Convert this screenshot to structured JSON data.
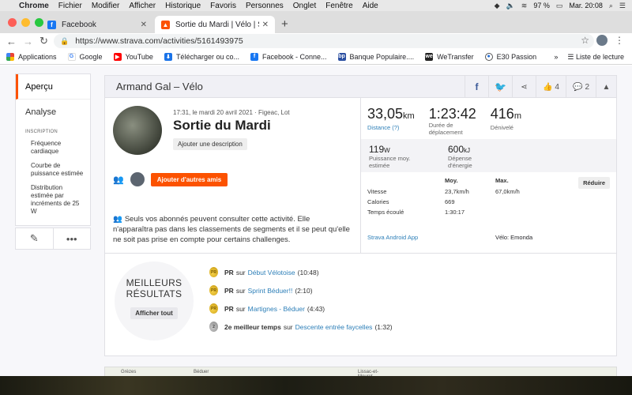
{
  "menubar": {
    "app": "Chrome",
    "items": [
      "Fichier",
      "Modifier",
      "Afficher",
      "Historique",
      "Favoris",
      "Personnes",
      "Onglet",
      "Fenêtre",
      "Aide"
    ],
    "battery": "97 %",
    "clock": "Mar. 20:08"
  },
  "tabs": [
    {
      "title": "Facebook",
      "icon": "facebook-icon",
      "color": "#1877f2"
    },
    {
      "title": "Sortie du Mardi | Vélo | Strava",
      "icon": "strava-icon",
      "color": "#fc5200"
    }
  ],
  "toolbar": {
    "url": "https://www.strava.com/activities/5161493975"
  },
  "bookmarks": {
    "items": [
      "Applications",
      "Google",
      "YouTube",
      "Télécharger ou co...",
      "Facebook - Conne...",
      "Banque Populaire....",
      "WeTransfer",
      "E30 Passion"
    ],
    "more": "»",
    "reading_list": "Liste de lecture"
  },
  "sidenav": {
    "overview": "Aperçu",
    "analysis": "Analyse",
    "caption": "INSCRIPTION",
    "subitems": [
      "Fréquence cardiaque",
      "Courbe de puissance estimée",
      "Distribution estimée par incréments de 25 W"
    ]
  },
  "activity": {
    "header": "Armand Gal – Vélo",
    "kudos": "4",
    "comments": "2",
    "meta": "17:31, le mardi 20 avril 2021 · Figeac, Lot",
    "title": "Sortie du Mardi",
    "add_description": "Ajouter une description",
    "add_friends": "Ajouter d'autres amis",
    "privacy": "Seuls vos abonnés peuvent consulter cette activité. Elle n'apparaîtra pas dans les classements de segments et il se peut qu'elle ne soit pas prise en compte pour certains challenges."
  },
  "stats": {
    "distance": {
      "value": "33,05",
      "unit": "km",
      "label": "Distance (?)"
    },
    "moving_time": {
      "value": "1:23:42",
      "label": "Durée de déplacement"
    },
    "elevation": {
      "value": "416",
      "unit": "m",
      "label": "Dénivelé"
    },
    "power": {
      "value": "119",
      "unit": "W",
      "label": "Puissance moy. estimée"
    },
    "energy": {
      "value": "600",
      "unit": "kJ",
      "label": "Dépense d'énergie"
    },
    "table_head": {
      "avg": "Moy.",
      "max": "Max."
    },
    "table_rows": [
      {
        "label": "Vitesse",
        "avg": "23,7km/h",
        "max": "67,0km/h"
      },
      {
        "label": "Calories",
        "avg": "669",
        "max": ""
      },
      {
        "label": "Temps écoulé",
        "avg": "1:30:17",
        "max": ""
      }
    ],
    "reduce": "Réduire",
    "device": "Strava Android App",
    "bike": "Vélo: Emonda"
  },
  "results": {
    "badge_line1": "MEILLEURS",
    "badge_line2": "RÉSULTATS",
    "show_all": "Afficher tout",
    "items": [
      {
        "label": "PR",
        "on": "sur",
        "segment": "Début Vélotoise",
        "time": "(10:48)",
        "medal": "gold"
      },
      {
        "label": "PR",
        "on": "sur",
        "segment": "Sprint Béduer!!",
        "time": "(2:10)",
        "medal": "gold"
      },
      {
        "label": "PR",
        "on": "sur",
        "segment": "Martignes - Béduer",
        "time": "(4:43)",
        "medal": "gold"
      },
      {
        "label": "2e meilleur temps",
        "on": "sur",
        "segment": "Descente entrée faycelles",
        "time": "(1:32)",
        "medal": "silver"
      }
    ]
  },
  "map": {
    "labels": [
      "Grèzes",
      "Béduer",
      "Lissac-et-Mouret"
    ]
  }
}
